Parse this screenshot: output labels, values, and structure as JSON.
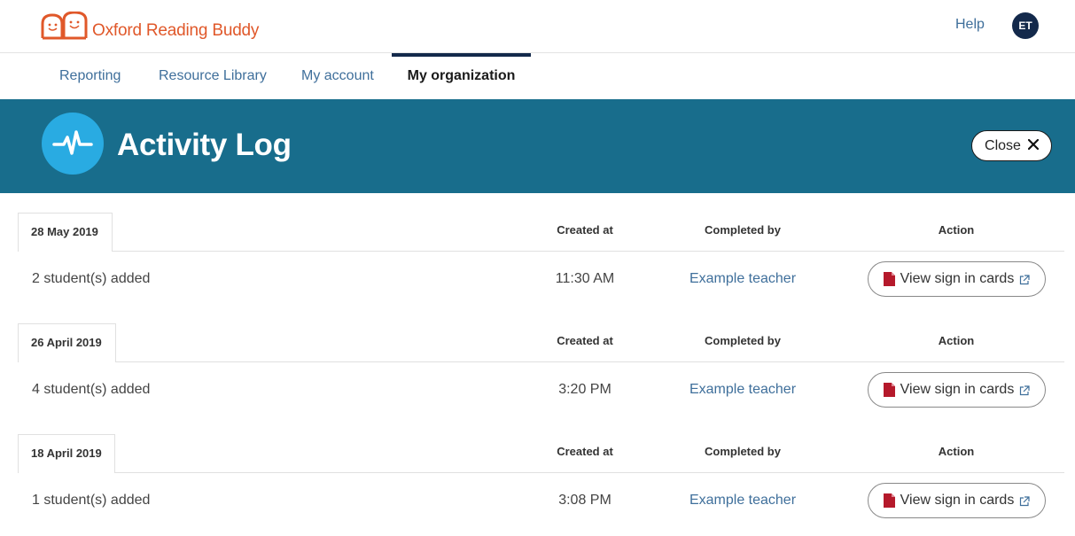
{
  "header": {
    "brand": "Oxford Reading Buddy",
    "help_label": "Help",
    "avatar_initials": "ET"
  },
  "nav": {
    "tabs": [
      {
        "label": "Reporting",
        "active": false
      },
      {
        "label": "Resource Library",
        "active": false
      },
      {
        "label": "My account",
        "active": false
      },
      {
        "label": "My organization",
        "active": true
      }
    ]
  },
  "banner": {
    "title": "Activity Log",
    "icon": "pulse-icon",
    "close_label": "Close"
  },
  "columns": {
    "created_at": "Created at",
    "completed_by": "Completed by",
    "action": "Action"
  },
  "log_groups": [
    {
      "date": "28 May 2019",
      "description": "2 student(s) added",
      "time": "11:30 AM",
      "completed_by": "Example teacher",
      "action_label": "View sign in cards"
    },
    {
      "date": "26 April 2019",
      "description": "4 student(s) added",
      "time": "3:20 PM",
      "completed_by": "Example teacher",
      "action_label": "View sign in cards"
    },
    {
      "date": "18 April 2019",
      "description": "1 student(s) added",
      "time": "3:08 PM",
      "completed_by": "Example teacher",
      "action_label": "View sign in cards"
    }
  ],
  "colors": {
    "brand_orange": "#e0582a",
    "banner_teal": "#186d8c",
    "banner_icon_blue": "#29abe2",
    "link_blue": "#3f6f9b",
    "navy": "#13294b",
    "pdf_red": "#b5192b"
  }
}
